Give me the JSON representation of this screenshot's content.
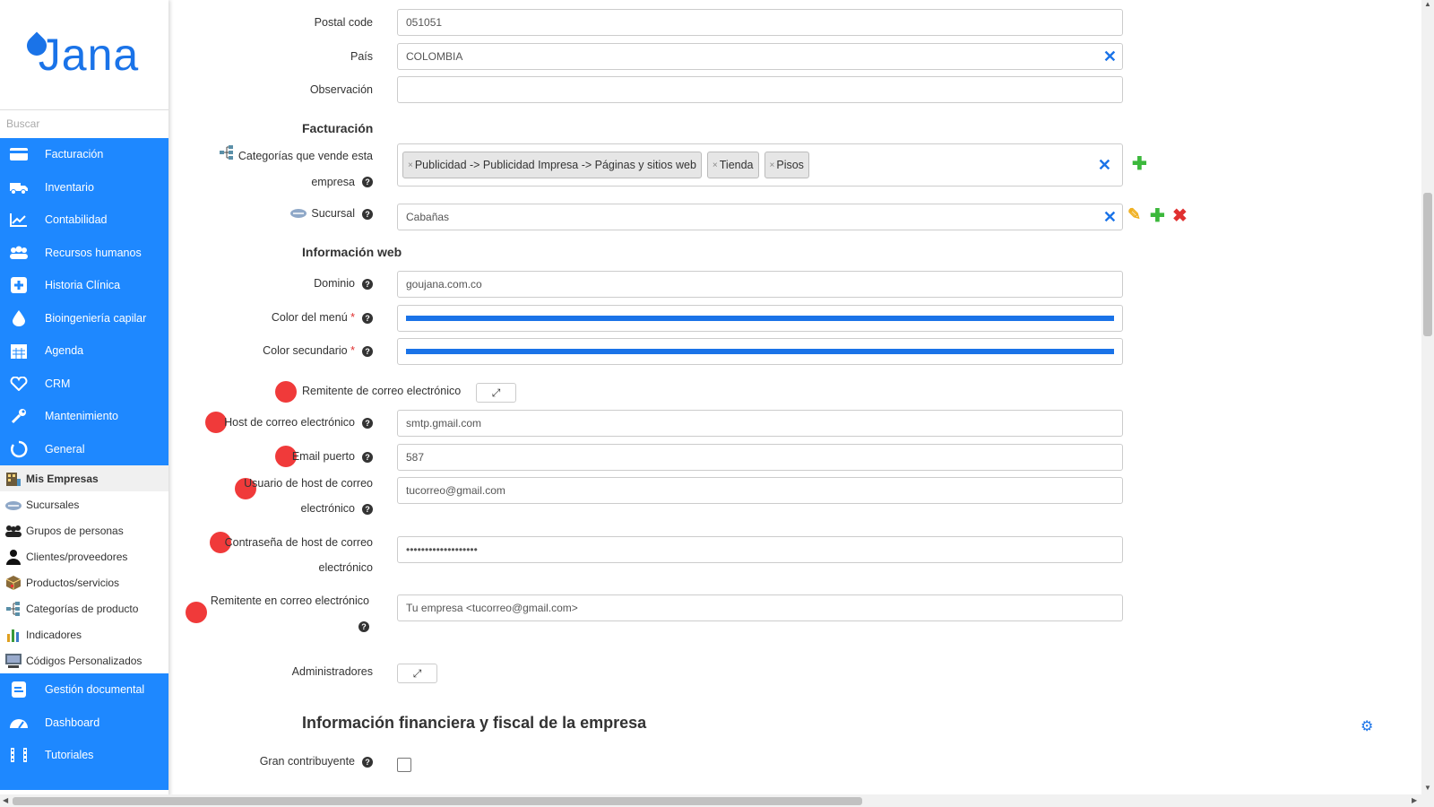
{
  "app": {
    "logo_text": "Jana",
    "search_placeholder": "Buscar"
  },
  "sidebar": {
    "main_items": [
      {
        "label": "Facturación",
        "icon": "credit-card-icon"
      },
      {
        "label": "Inventario",
        "icon": "truck-icon"
      },
      {
        "label": "Contabilidad",
        "icon": "chart-line-icon"
      },
      {
        "label": "Recursos humanos",
        "icon": "users-icon"
      },
      {
        "label": "Historia Clínica",
        "icon": "medical-plus-icon"
      },
      {
        "label": "Bioingeniería capilar",
        "icon": "drop-icon"
      },
      {
        "label": "Agenda",
        "icon": "calendar-icon"
      },
      {
        "label": "CRM",
        "icon": "heart-icon"
      },
      {
        "label": "Mantenimiento",
        "icon": "wrench-icon"
      },
      {
        "label": "General",
        "icon": "circle-icon"
      }
    ],
    "sub_items": [
      {
        "label": "Mis Empresas",
        "icon": "building-icon",
        "active": true
      },
      {
        "label": "Sucursales",
        "icon": "handshake-icon"
      },
      {
        "label": "Grupos de personas",
        "icon": "group-icon"
      },
      {
        "label": "Clientes/proveedores",
        "icon": "person-icon"
      },
      {
        "label": "Productos/servicios",
        "icon": "box-icon"
      },
      {
        "label": "Categorías de producto",
        "icon": "tree-icon"
      },
      {
        "label": "Indicadores",
        "icon": "bar-chart-icon"
      },
      {
        "label": "Códigos Personalizados",
        "icon": "monitor-icon"
      }
    ],
    "bottom_items": [
      {
        "label": "Gestión documental",
        "icon": "document-icon"
      },
      {
        "label": "Dashboard",
        "icon": "gauge-icon"
      },
      {
        "label": "Tutoriales",
        "icon": "film-icon"
      }
    ]
  },
  "form": {
    "postal_code": {
      "label": "Postal code",
      "value": "051051"
    },
    "pais": {
      "label": "País",
      "value": "COLOMBIA"
    },
    "observacion": {
      "label": "Observación",
      "value": ""
    },
    "facturacion_title": "Facturación",
    "categorias": {
      "label_line1": "Categorías que vende esta",
      "label_line2": "empresa",
      "tags": [
        "Publicidad -> Publicidad Impresa -> Páginas y sitios web",
        "Tienda",
        "Pisos"
      ],
      "tag_remove": "×"
    },
    "sucursal": {
      "label": "Sucursal",
      "value": "Cabañas"
    },
    "web_title": "Información web",
    "dominio": {
      "label": "Dominio",
      "value": "goujana.com.co"
    },
    "color_menu": {
      "label": "Color del menú",
      "required": "*",
      "color": "#1a73e8"
    },
    "color_secundario": {
      "label": "Color secundario",
      "required": "*",
      "color": "#1a73e8"
    },
    "remitente_correo": {
      "label": "Remitente de correo electrónico",
      "button": "⤢"
    },
    "host_correo": {
      "label": "Host de correo electrónico",
      "value": "smtp.gmail.com"
    },
    "email_puerto": {
      "label": "Email puerto",
      "value": "587"
    },
    "usuario_host": {
      "label_line1": "Usuario de host de correo",
      "label_line2": "electrónico",
      "value": "tucorreo@gmail.com"
    },
    "contrasena_host": {
      "label_line1": "Contraseña de host de correo",
      "label_line2": "electrónico",
      "value": "•••••••••••••••••••"
    },
    "remitente_en_correo": {
      "label": "Remitente en correo electrónico",
      "value": "Tu empresa <tucorreo@gmail.com>"
    },
    "administradores": {
      "label": "Administradores",
      "button": "⤢"
    },
    "financiera_title": "Información financiera y fiscal de la empresa",
    "gran_contribuyente": {
      "label": "Gran contribuyente",
      "checked": false
    }
  },
  "help_glyph": "?",
  "clear_glyph": "✕",
  "colors": {
    "primary": "#1e88ff",
    "add": "#3cb83c",
    "delete": "#e03030",
    "edit": "#f0b020",
    "annotation_dot": "#f03a3a"
  }
}
